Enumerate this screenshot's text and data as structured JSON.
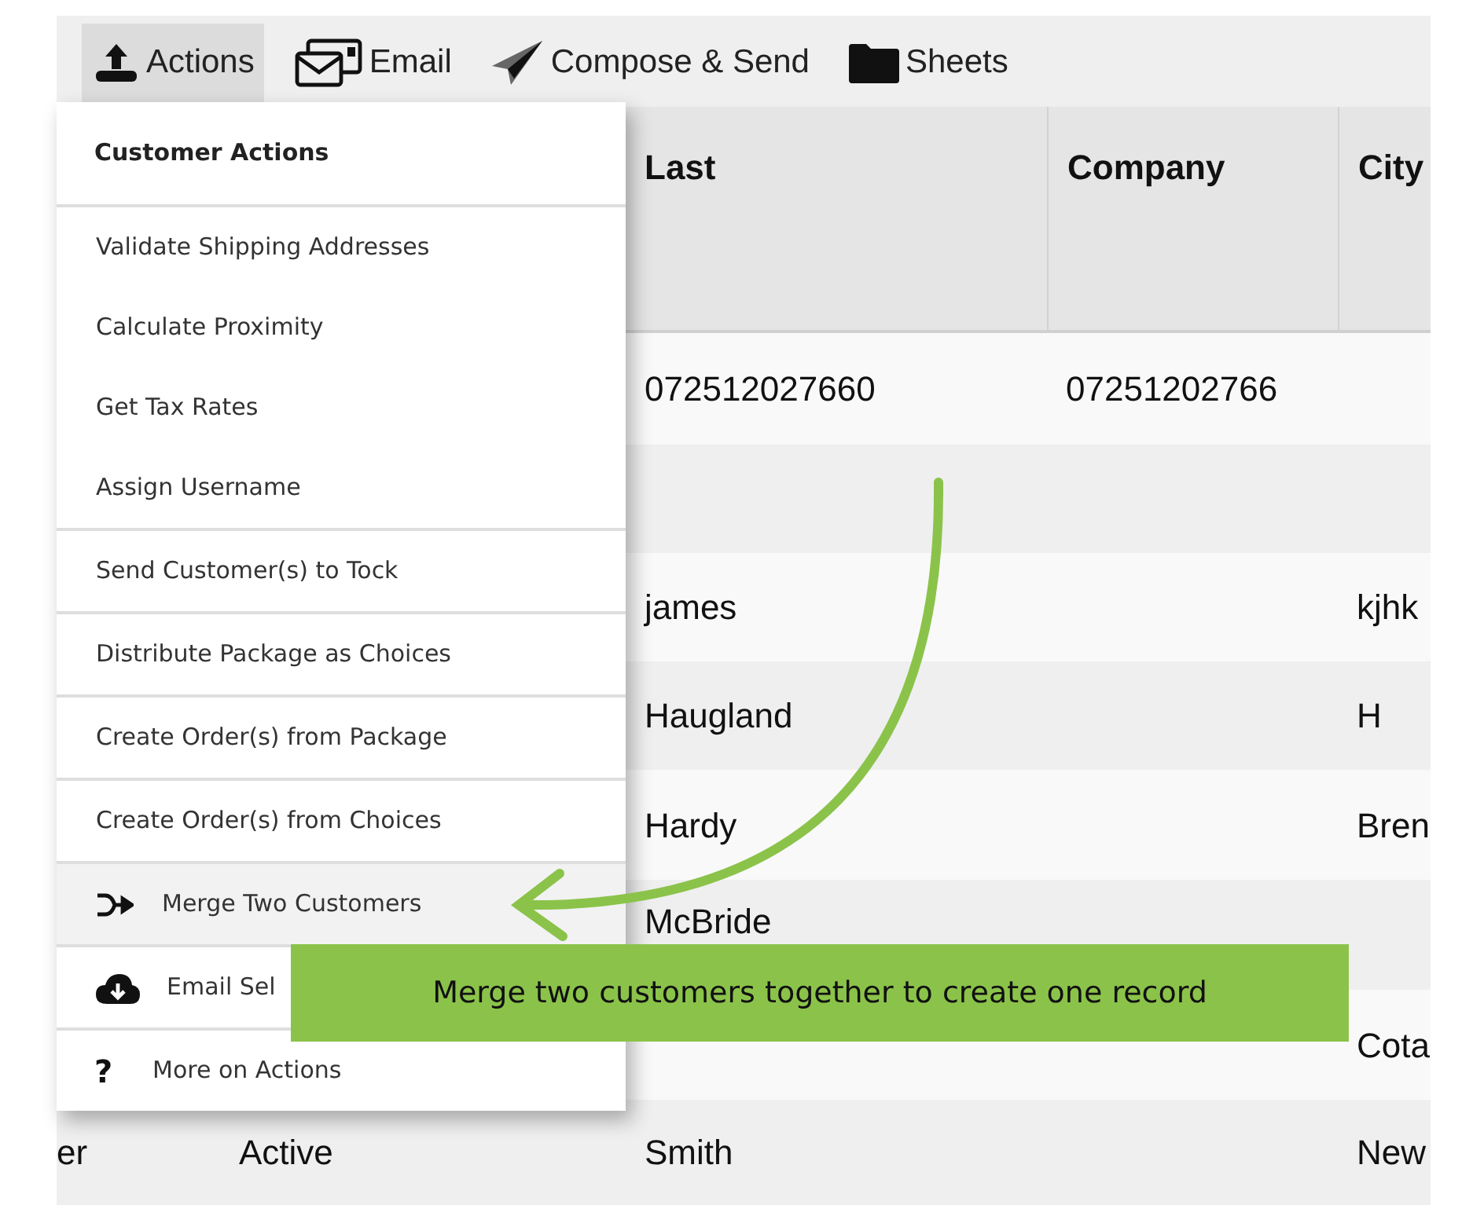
{
  "toolbar": [
    {
      "label": "Actions",
      "kind": "upload",
      "selected": true
    },
    {
      "label": "Email",
      "kind": "mail",
      "selected": false
    },
    {
      "label": "Compose & Send",
      "kind": "plane",
      "selected": false
    },
    {
      "label": "Sheets",
      "kind": "folder",
      "selected": false
    }
  ],
  "table": {
    "columns": [
      null,
      null,
      "Last",
      "Company",
      "City"
    ],
    "rows": [
      [
        null,
        null,
        "072512027660",
        "07251202766",
        null
      ],
      [
        null,
        null,
        null,
        null,
        null
      ],
      [
        null,
        null,
        "james",
        null,
        "kjhk"
      ],
      [
        null,
        null,
        "Haugland",
        null,
        "H"
      ],
      [
        null,
        null,
        "Hardy",
        null,
        "Bren"
      ],
      [
        null,
        null,
        "McBride",
        null,
        null
      ],
      [
        null,
        null,
        null,
        null,
        "Cota"
      ],
      [
        "er",
        "Active",
        "Smith",
        null,
        "New"
      ]
    ]
  },
  "menu": {
    "title": "Customer Actions",
    "groups": [
      [
        {
          "label": "Validate Shipping Addresses",
          "kind": "plain",
          "selected": false
        },
        {
          "label": "Calculate Proximity",
          "kind": "plain",
          "selected": false
        },
        {
          "label": "Get Tax Rates",
          "kind": "plain",
          "selected": false
        },
        {
          "label": "Assign Username",
          "kind": "plain",
          "selected": false
        }
      ],
      [
        {
          "label": "Send Customer(s) to Tock",
          "kind": "plain",
          "selected": false
        }
      ],
      [
        {
          "label": "Distribute Package as Choices",
          "kind": "plain",
          "selected": false
        }
      ],
      [
        {
          "label": "Create Order(s) from Package",
          "kind": "plain",
          "selected": false
        }
      ],
      [
        {
          "label": "Create Order(s) from Choices",
          "kind": "plain",
          "selected": false
        }
      ],
      [
        {
          "label": "Merge Two Customers",
          "kind": "merge",
          "selected": true
        }
      ],
      [
        {
          "label": "Email Sel",
          "kind": "cloud",
          "selected": false
        }
      ],
      [
        {
          "label": "More on Actions",
          "kind": "help",
          "icon_text": "?",
          "selected": false
        }
      ]
    ]
  },
  "callout": {
    "text": "Merge two customers together to create one record"
  }
}
